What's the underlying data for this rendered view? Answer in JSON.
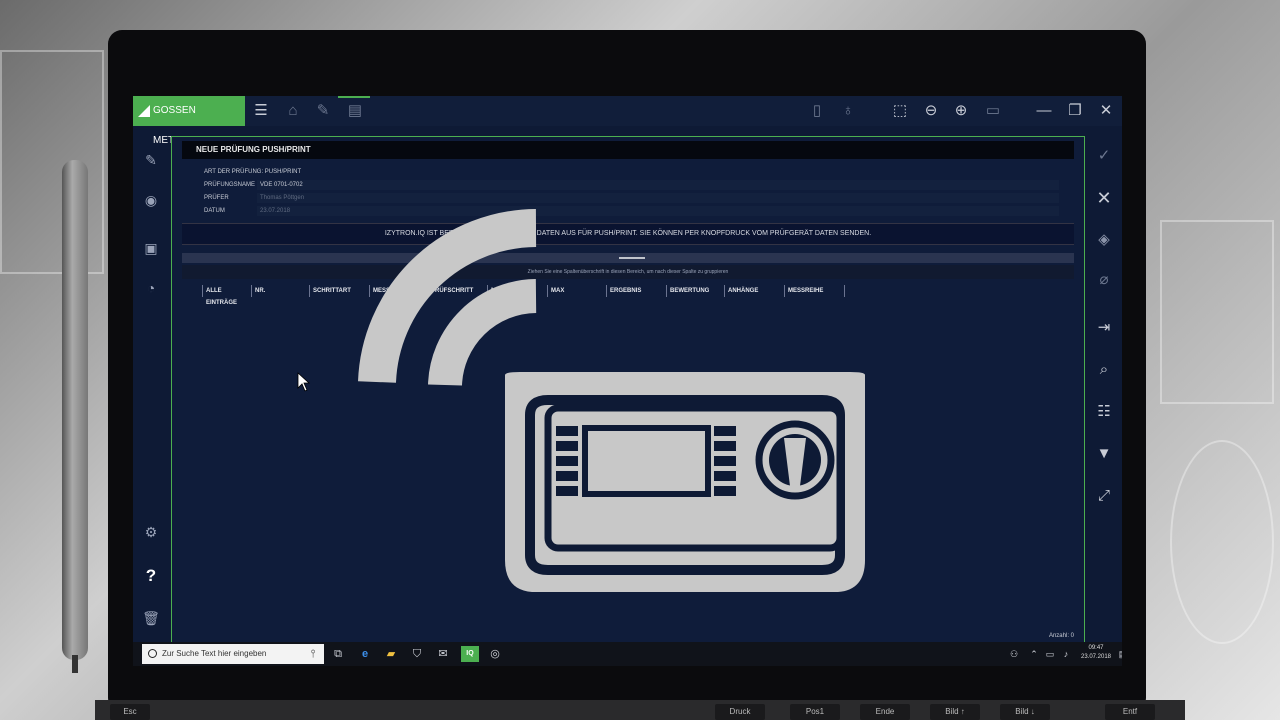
{
  "logo": {
    "text": "GOSSEN METRAWATT"
  },
  "panel": {
    "title": "NEUE PRÜFUNG PUSH/PRINT",
    "fields": [
      {
        "label": "ART DER PRÜFUNG: PUSH/PRINT",
        "value": ""
      },
      {
        "label": "PRÜFUNGSNAME",
        "value": "VDE 0701-0702"
      },
      {
        "label": "PRÜFER",
        "value": "Thomas Pöttgen"
      },
      {
        "label": "DATUM",
        "value": "23.07.2018"
      }
    ],
    "info": "IZYTRON.IQ IST BEREIT ZUM EMPFANG DER DATEN AUS FÜR PUSH/PRINT. SIE KÖNNEN PER KNOPFDRUCK VOM PRÜFGERÄT DATEN SENDEN.",
    "group_hint": "Ziehen Sie eine Spaltenüberschrift in diesen Bereich, um nach dieser Spalte zu gruppieren",
    "columns": [
      "ALLE EINTRÄGE",
      "NR.",
      "SCHRITTART",
      "MESSWERT",
      "PRÜFSCHRITT",
      "MIN",
      "MAX",
      "ERGEBNIS",
      "BEWERTUNG",
      "ANHÄNGE",
      "MESSREIHE"
    ],
    "count": "Anzahl: 0"
  },
  "taskbar": {
    "search_placeholder": "Zur Suche Text hier eingeben",
    "iq_label": "IQ",
    "time": "09:47",
    "date": "23.07.2018"
  },
  "keyboard": {
    "keys": [
      "Esc",
      "Druck",
      "Pos1",
      "Ende",
      "Bild ↑",
      "Bild ↓",
      "Entf"
    ]
  },
  "colors": {
    "accent": "#4caf50",
    "background": "#0e1a35",
    "overlay": "#c8c8c8"
  }
}
